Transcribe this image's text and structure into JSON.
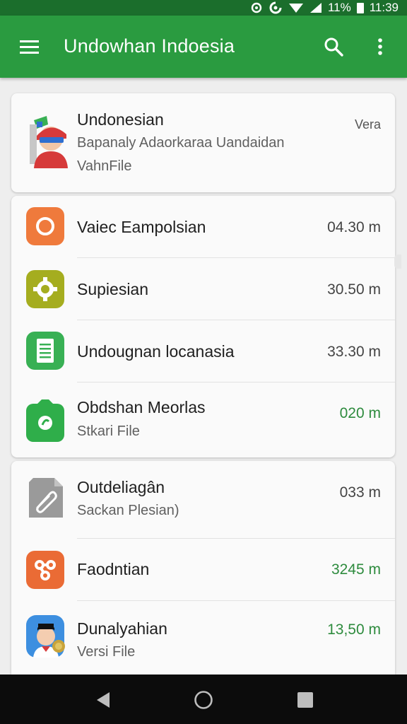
{
  "status_bar": {
    "battery": "11%",
    "time": "11:39"
  },
  "app_bar": {
    "title": "Undowhan Indoesia",
    "menu_icon": "hamburger-menu-icon",
    "search_icon": "search-icon",
    "more_icon": "more-vert-icon"
  },
  "header_card": {
    "title": "Undonesian",
    "subtitle": "Bapanaly Adaorkaraa Uandaidan",
    "tertiary": "VahnFile",
    "meta": "Vera",
    "icon": "person-avatar-icon"
  },
  "list_1": [
    {
      "title": "Vaiec Eampolsian",
      "meta": "04.30 m",
      "meta_color": "#444444",
      "icon": "orange-circle-icon",
      "icon_bg": "#ef7a3c"
    },
    {
      "title": "Supiesian",
      "meta": "30.50 m",
      "meta_color": "#444444",
      "icon": "gear-icon",
      "icon_bg": "#a5ad1f"
    },
    {
      "title": "Undougnan locanasia",
      "meta": "33.30 m",
      "meta_color": "#444444",
      "icon": "document-icon",
      "icon_bg": "#38b054"
    },
    {
      "title": "Obdshan Meorlas",
      "subtitle": "Stkari File",
      "meta": "020 m",
      "meta_color": "#2e8b3e",
      "icon": "camera-icon",
      "icon_bg": "#2fae4a"
    }
  ],
  "list_2": [
    {
      "title": "Outdeliagân",
      "subtitle": "Sackan Plesian)",
      "meta": "033 m",
      "meta_color": "#444444",
      "icon": "paperclip-file-icon",
      "icon_bg": "#9a9a9a"
    },
    {
      "title": "Faodntian",
      "meta": "3245 m",
      "meta_color": "#2e8b3e",
      "icon": "share-nodes-icon",
      "icon_bg": "#ea6b35"
    },
    {
      "title": "Dunalyahian",
      "subtitle": "Versi File",
      "meta": "13,50 m",
      "meta_color": "#2e8b3e",
      "icon": "person-avatar-icon",
      "icon_bg": "#3d8fe0"
    }
  ],
  "nav_bar": {
    "back_icon": "back-triangle-icon",
    "home_icon": "home-circle-icon",
    "recent_icon": "recent-square-icon"
  }
}
